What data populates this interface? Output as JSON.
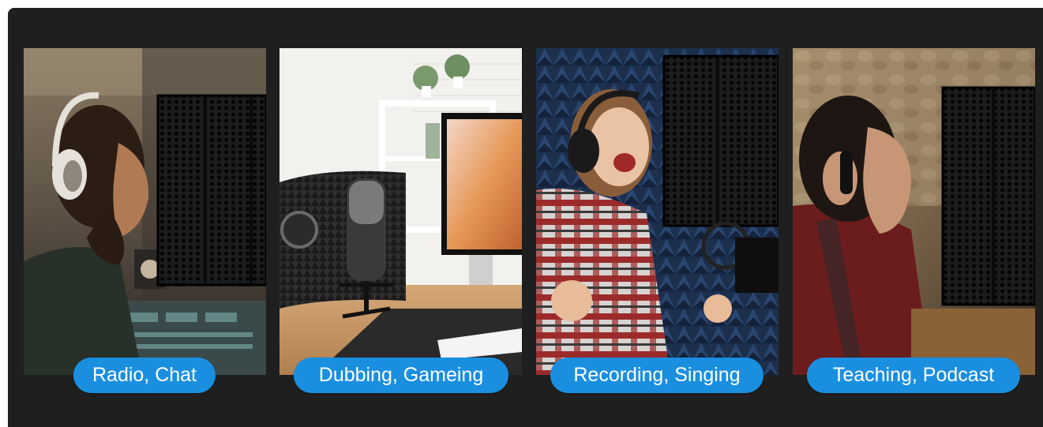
{
  "panel": {
    "background": "#1f1f1f",
    "accent": "#1a8fe0"
  },
  "cards": [
    {
      "label": "Radio, Chat",
      "scene": "man-with-headphones-radio-studio"
    },
    {
      "label": "Dubbing, Gameing",
      "scene": "desk-microphone-isolation-shield"
    },
    {
      "label": "Recording, Singing",
      "scene": "woman-singing-foam-booth"
    },
    {
      "label": "Teaching, Podcast",
      "scene": "woman-with-headphones-stone-wall"
    }
  ]
}
